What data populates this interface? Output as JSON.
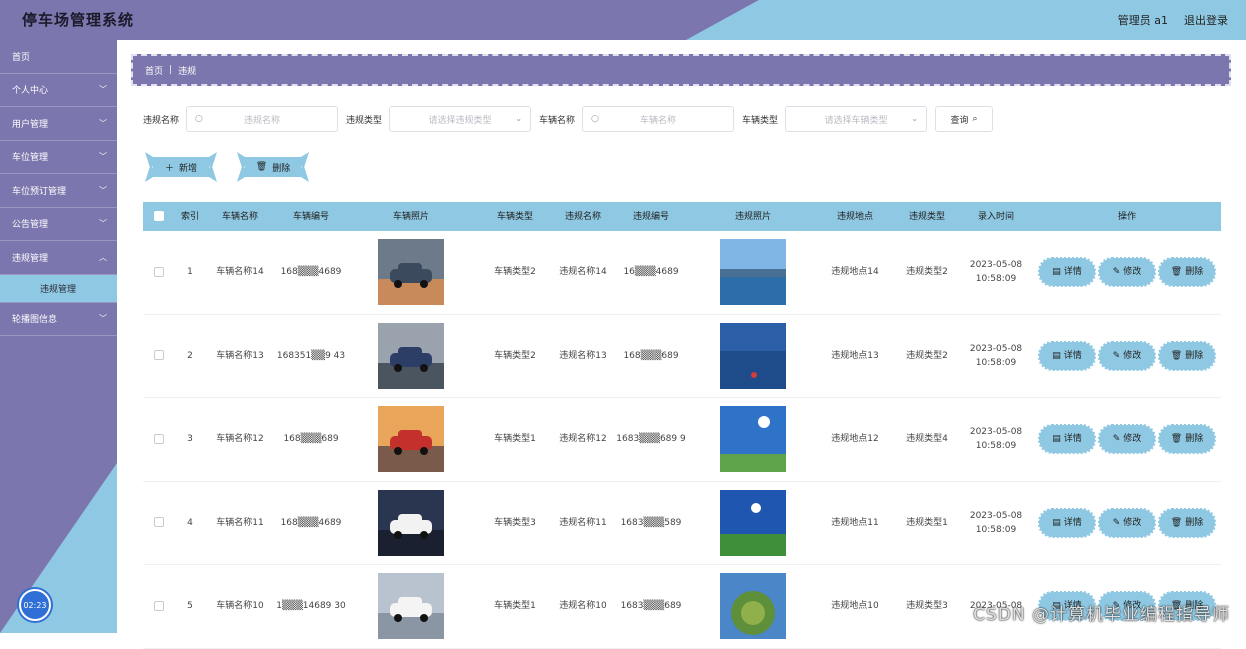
{
  "app": {
    "title": "停车场管理系统"
  },
  "header": {
    "user_label": "管理员 a1",
    "logout_label": "退出登录"
  },
  "sidebar": {
    "items": [
      {
        "label": "首页",
        "expandable": false
      },
      {
        "label": "个人中心",
        "expandable": true
      },
      {
        "label": "用户管理",
        "expandable": true
      },
      {
        "label": "车位管理",
        "expandable": true
      },
      {
        "label": "车位预订管理",
        "expandable": true
      },
      {
        "label": "公告管理",
        "expandable": true
      },
      {
        "label": "违规管理",
        "expandable": true,
        "expanded": true
      },
      {
        "label": "违规管理",
        "sub": true
      },
      {
        "label": "轮播图信息",
        "expandable": true
      }
    ],
    "clock": "02:23"
  },
  "breadcrumb": {
    "home": "首页",
    "separator": "|",
    "current": "违规"
  },
  "search": {
    "violation_name_label": "违规名称",
    "violation_name_placeholder": "违规名称",
    "violation_type_label": "违规类型",
    "violation_type_placeholder": "请选择违规类型",
    "vehicle_name_label": "车辆名称",
    "vehicle_name_placeholder": "车辆名称",
    "vehicle_type_label": "车辆类型",
    "vehicle_type_placeholder": "请选择车辆类型",
    "query_label": "查询"
  },
  "actions": {
    "add_label": "新增",
    "delete_label": "删除"
  },
  "table": {
    "headers": [
      "索引",
      "车辆名称",
      "车辆编号",
      "车辆照片",
      "车辆类型",
      "违规名称",
      "违规编号",
      "违规照片",
      "违规地点",
      "违规类型",
      "录入时间",
      "操作"
    ],
    "op_labels": {
      "detail": "详情",
      "edit": "修改",
      "delete": "删除"
    },
    "rows": [
      {
        "index": "1",
        "vehicle_name": "车辆名称14",
        "vehicle_no": "168▒▒▒4689",
        "vehicle_type": "车辆类型2",
        "violation_name": "违规名称14",
        "violation_no": "16▒▒▒4689",
        "location": "违规地点14",
        "violation_type": "违规类型2",
        "time_date": "2023-05-08",
        "time_clock": "10:58:09",
        "car": "road",
        "scene": "lake"
      },
      {
        "index": "2",
        "vehicle_name": "车辆名称13",
        "vehicle_no": "168351▒▒9 43",
        "vehicle_type": "车辆类型2",
        "violation_name": "违规名称13",
        "violation_no": "168▒▒▒689",
        "location": "违规地点13",
        "violation_type": "违规类型2",
        "time_date": "2023-05-08",
        "time_clock": "10:58:09",
        "car": "showroom",
        "scene": "sea"
      },
      {
        "index": "3",
        "vehicle_name": "车辆名称12",
        "vehicle_no": "168▒▒▒689",
        "vehicle_type": "车辆类型1",
        "violation_name": "违规名称12",
        "violation_no": "1683▒▒▒689 9",
        "location": "违规地点12",
        "violation_type": "违规类型4",
        "time_date": "2023-05-08",
        "time_clock": "10:58:09",
        "car": "sunset",
        "scene": "sky"
      },
      {
        "index": "4",
        "vehicle_name": "车辆名称11",
        "vehicle_no": "168▒▒▒4689",
        "vehicle_type": "车辆类型3",
        "violation_name": "违规名称11",
        "violation_no": "1683▒▒▒589",
        "location": "违规地点11",
        "violation_type": "违规类型1",
        "time_date": "2023-05-08",
        "time_clock": "10:58:09",
        "car": "white",
        "scene": "field"
      },
      {
        "index": "5",
        "vehicle_name": "车辆名称10",
        "vehicle_no": "1▒▒▒14689 30",
        "vehicle_type": "车辆类型1",
        "violation_name": "违规名称10",
        "violation_no": "1683▒▒▒689",
        "location": "违规地点10",
        "violation_type": "违规类型3",
        "time_date": "2023-05-08",
        "time_clock": "",
        "car": "van",
        "scene": "planet"
      }
    ]
  },
  "watermark": "CSDN @计算机毕业编程指导师"
}
